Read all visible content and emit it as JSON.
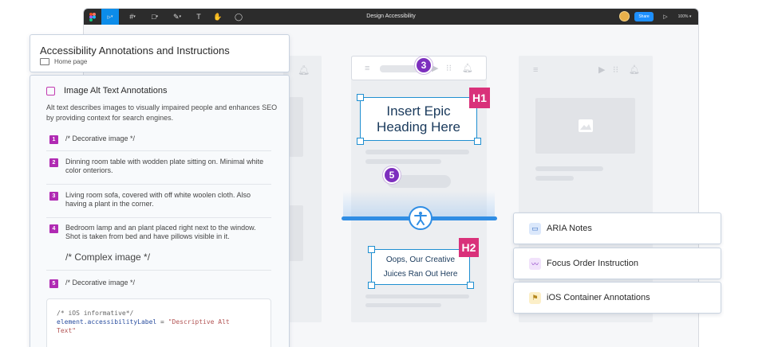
{
  "window": {
    "title": "Design Accessibility",
    "share_label": "Share",
    "zoom": "100%"
  },
  "title_card": {
    "title": "Accessibility Annotations and Instructions",
    "page": "Home page"
  },
  "panel": {
    "heading": "Image Alt Text Annotations",
    "description": "Alt text describes images to visually impaired people and enhances SEO by providing context for search engines.",
    "items": [
      {
        "num": "1",
        "text": "/* Decorative image */"
      },
      {
        "num": "2",
        "text": "Dinning room table with wodden plate sitting on. Minimal white color onteriors."
      },
      {
        "num": "3",
        "text": "Living room sofa, covered with off white woolen cloth. Also having a plant in the corner."
      },
      {
        "num": "4",
        "text": "Bedroom lamp and an plant placed right next to the window. Shot is taken from bed and have pillows visible in it.",
        "extra": "/* Complex image */"
      },
      {
        "num": "5",
        "text": "/* Decorative image */"
      }
    ],
    "code": {
      "comment": "/* iOS informative*/",
      "line1": "element.accessibilityLabel",
      "equals": " = ",
      "string1": "\"Descriptive Alt",
      "string2": "Text\""
    }
  },
  "mockup": {
    "heading1": "Insert Epic Heading Here",
    "heading1_line1": "Insert Epic",
    "heading1_line2": "Heading Here",
    "tag_h1": "H1",
    "tag_h2": "H2",
    "heading2_line1": "Oops, Our Creative",
    "heading2_line2": "Juices Ran Out Here",
    "badge_3": "3",
    "badge_5": "5"
  },
  "side_cards": [
    {
      "label": "ARIA Notes",
      "icon": "message-icon",
      "color": "#dbe8fb"
    },
    {
      "label": "Focus Order Instruction",
      "icon": "trend-icon",
      "color": "#f1e2fb"
    },
    {
      "label": "iOS Container Annotations",
      "icon": "flag-icon",
      "color": "#fcefc8"
    }
  ],
  "colors": {
    "accent_blue": "#1f8fd1",
    "heading_tag": "#d9317a",
    "badge_purple": "#7d2fbe",
    "item_num": "#b02ab3"
  }
}
